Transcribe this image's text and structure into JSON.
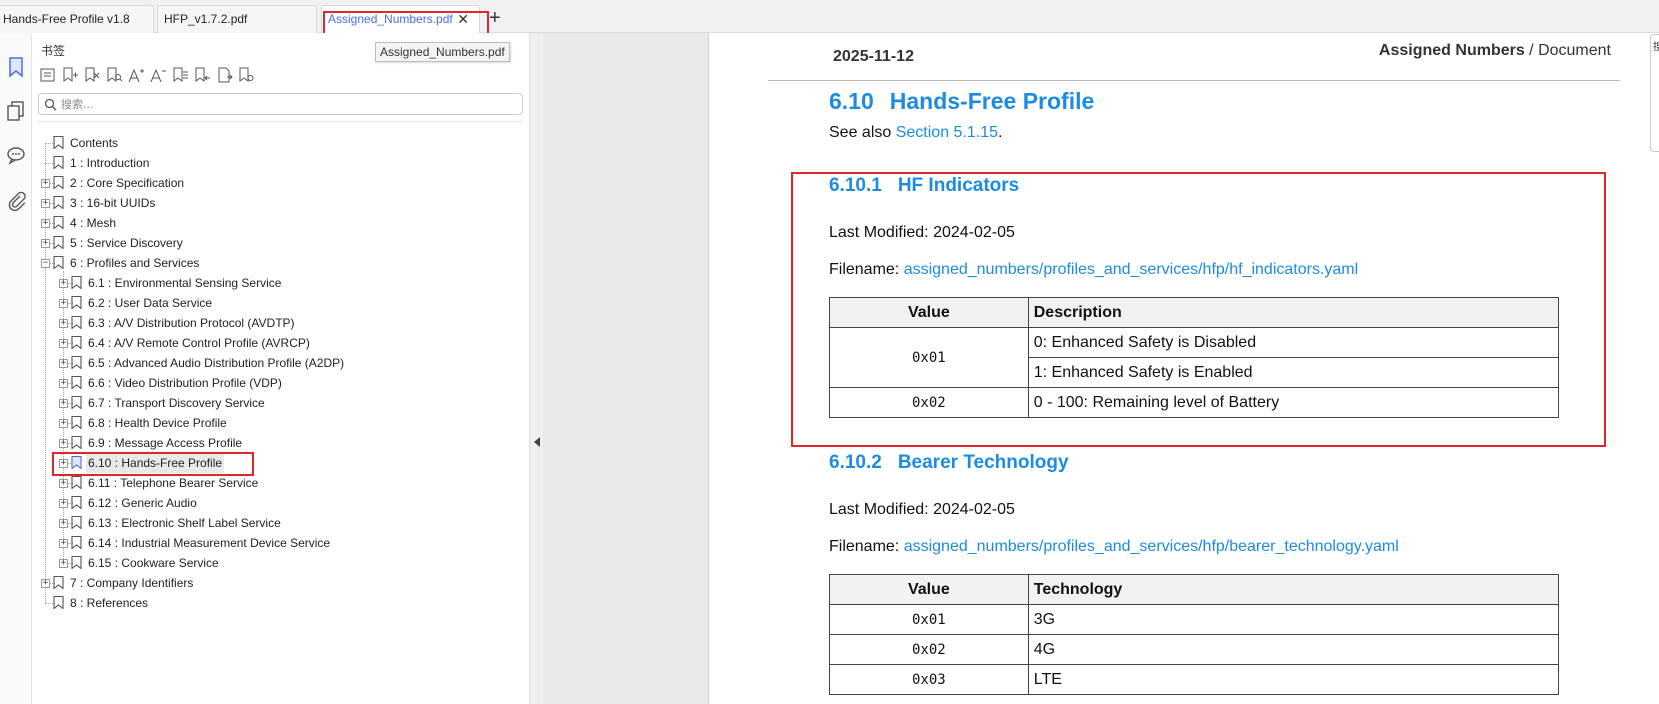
{
  "tabs": [
    {
      "label": "Hands-Free Profile v1.8",
      "active": false
    },
    {
      "label": "HFP_v1.7.2.pdf",
      "active": false
    },
    {
      "label": "Assigned_Numbers.pdf",
      "active": true
    }
  ],
  "tab_close_glyph": "✕",
  "new_tab_glyph": "+",
  "tooltip": "Assigned_Numbers.pdf",
  "rail_icons": [
    "bookmark-icon",
    "pages-icon",
    "comment-icon",
    "attachment-icon"
  ],
  "bookmark_panel": {
    "title": "书签",
    "toolbar_icons": [
      "expand-all-icon",
      "add-bookmark-icon",
      "delete-bookmark-icon",
      "find-bookmark-icon",
      "font-increase-icon",
      "font-decrease-icon",
      "bookmark-from-text-icon",
      "import-bookmark-icon",
      "export-bookmark-icon",
      "bookmark-properties-icon"
    ],
    "search_placeholder": "搜索...",
    "tree": [
      {
        "label": "Contents",
        "level": 0,
        "expander": "none"
      },
      {
        "label": "1 : Introduction",
        "level": 0,
        "expander": "none"
      },
      {
        "label": "2 : Core Specification",
        "level": 0,
        "expander": "plus"
      },
      {
        "label": "3 : 16-bit UUIDs",
        "level": 0,
        "expander": "plus"
      },
      {
        "label": "4 : Mesh",
        "level": 0,
        "expander": "plus"
      },
      {
        "label": "5 : Service Discovery",
        "level": 0,
        "expander": "plus"
      },
      {
        "label": "6 : Profiles and Services",
        "level": 0,
        "expander": "minus"
      },
      {
        "label": "6.1 : Environmental Sensing Service",
        "level": 1,
        "expander": "plus"
      },
      {
        "label": "6.2 : User Data Service",
        "level": 1,
        "expander": "plus"
      },
      {
        "label": "6.3 : A/V Distribution Protocol (AVDTP)",
        "level": 1,
        "expander": "plus"
      },
      {
        "label": "6.4 : A/V Remote Control Profile (AVRCP)",
        "level": 1,
        "expander": "plus"
      },
      {
        "label": "6.5 : Advanced Audio Distribution Profile (A2DP)",
        "level": 1,
        "expander": "plus"
      },
      {
        "label": "6.6 : Video Distribution Profile (VDP)",
        "level": 1,
        "expander": "plus"
      },
      {
        "label": "6.7 : Transport Discovery Service",
        "level": 1,
        "expander": "plus"
      },
      {
        "label": "6.8 : Health Device Profile",
        "level": 1,
        "expander": "plus"
      },
      {
        "label": "6.9 : Message Access Profile",
        "level": 1,
        "expander": "plus"
      },
      {
        "label": "6.10 : Hands-Free Profile",
        "level": 1,
        "expander": "plus",
        "selected": true
      },
      {
        "label": "6.11 : Telephone Bearer Service",
        "level": 1,
        "expander": "plus"
      },
      {
        "label": "6.12 : Generic Audio",
        "level": 1,
        "expander": "plus"
      },
      {
        "label": "6.13 : Electronic Shelf Label Service",
        "level": 1,
        "expander": "plus"
      },
      {
        "label": "6.14 : Industrial Measurement Device Service",
        "level": 1,
        "expander": "plus"
      },
      {
        "label": "6.15 : Cookware Service",
        "level": 1,
        "expander": "plus"
      },
      {
        "label": "7 : Company Identifiers",
        "level": 0,
        "expander": "plus"
      },
      {
        "label": "8 : References",
        "level": 0,
        "expander": "none"
      }
    ]
  },
  "document": {
    "header_date": "2025-11-12",
    "header_title_bold": "Assigned Numbers",
    "header_title_rest": " / Document",
    "section_number": "6.10",
    "section_title": "Hands-Free Profile",
    "see_also_prefix": "See also ",
    "see_also_link": "Section 5.1.15",
    "see_also_suffix": ".",
    "hf_indicators": {
      "number": "6.10.1",
      "title": "HF Indicators",
      "last_modified_label": "Last Modified: ",
      "last_modified": "2024-02-05",
      "filename_label": "Filename: ",
      "filename": "assigned_numbers/profiles_and_services/hfp/hf_indicators.yaml",
      "columns": [
        "Value",
        "Description"
      ],
      "rows": [
        {
          "value": "0x01",
          "descriptions": [
            "0: Enhanced Safety is Disabled",
            "1: Enhanced Safety is Enabled"
          ]
        },
        {
          "value": "0x02",
          "descriptions": [
            "0 - 100: Remaining level of Battery"
          ]
        }
      ]
    },
    "bearer_technology": {
      "number": "6.10.2",
      "title": "Bearer Technology",
      "last_modified_label": "Last Modified: ",
      "last_modified": "2024-02-05",
      "filename_label": "Filename: ",
      "filename": "assigned_numbers/profiles_and_services/hfp/bearer_technology.yaml",
      "columns": [
        "Value",
        "Technology"
      ],
      "rows": [
        {
          "value": "0x01",
          "technology": "3G"
        },
        {
          "value": "0x02",
          "technology": "4G"
        },
        {
          "value": "0x03",
          "technology": "LTE"
        }
      ]
    }
  },
  "edge_popup_text": "搜",
  "colors": {
    "link": "#1d8be0",
    "highlight": "#e0262c",
    "active_tab": "#4a6ee0"
  }
}
